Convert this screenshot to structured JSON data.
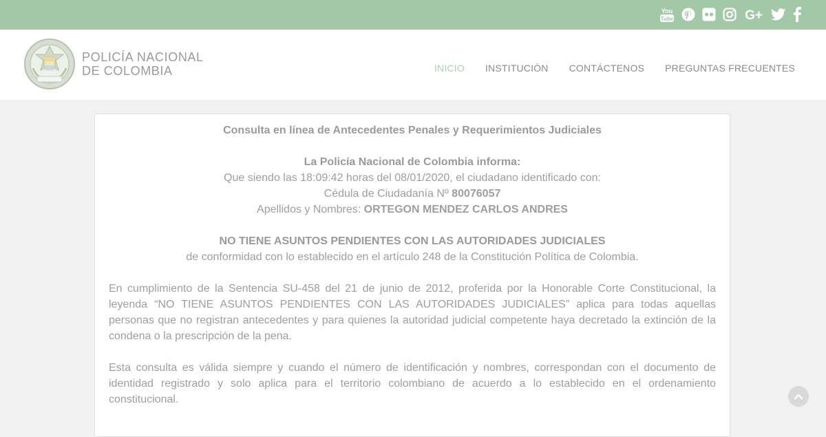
{
  "social": {
    "icons": [
      "youtube-icon",
      "pinterest-icon",
      "flickr-icon",
      "instagram-icon",
      "google-plus-icon",
      "twitter-icon",
      "facebook-icon"
    ],
    "youtube_text": "You",
    "youtube_text2": "Tube",
    "gplus_text": "G+"
  },
  "brand": {
    "line1": "POLICÍA NACIONAL",
    "line2": "DE COLOMBIA"
  },
  "nav": {
    "items": [
      "INICIO",
      "INSTITUCIÓN",
      "CONTÁCTENOS",
      "PREGUNTAS FRECUENTES"
    ],
    "active": "INICIO"
  },
  "result": {
    "title": "Consulta en línea de Antecedentes Penales y Requerimientos Judiciales",
    "informa": "La Policía Nacional de Colombia informa:",
    "line_time": "Que siendo las 18:09:42 horas del 08/01/2020, el ciudadano identificado con:",
    "cedula_label": "Cédula de Ciudadanía Nº ",
    "cedula_number": "80076057",
    "name_label": "Apellidos y Nombres: ",
    "name_value": "ORTEGON MENDEZ CARLOS ANDRES",
    "status": "NO TIENE ASUNTOS PENDIENTES CON LAS AUTORIDADES JUDICIALES",
    "status_note": "de conformidad con lo establecido en el artículo 248 de la Constitución Política de Colombia.",
    "paragraph1": "En cumplimiento de la Sentencia SU-458 del 21 de junio de 2012, proferida por la Honorable Corte Constitucional, la leyenda “NO TIENE ASUNTOS PENDIENTES CON LAS AUTORIDADES JUDICIALES” aplica para todas aquellas personas que no registran antecedentes y para quienes la autoridad judicial competente haya decretado la extinción de la condena o la prescripción de la pena.",
    "paragraph2": "Esta consulta es válida siempre y cuando el número de identificación y nombres, correspondan con el documento de identidad registrado y solo aplica para el territorio colombiano de acuerdo a lo establecido en el ordenamiento constitucional."
  },
  "colors": {
    "topbar": "#a3c8a8",
    "nav_active": "#a6d4ad",
    "text": "#9e9e9e"
  }
}
